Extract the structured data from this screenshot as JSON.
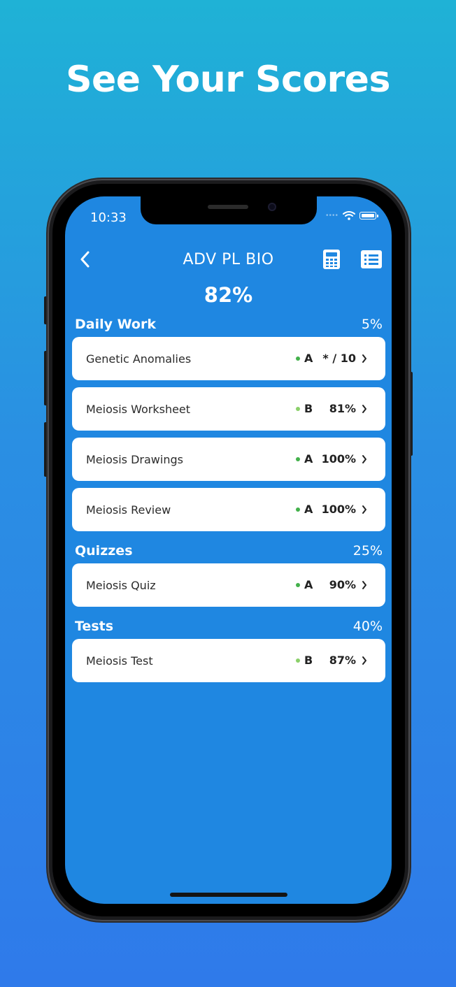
{
  "headline": "See Your Scores",
  "status_bar": {
    "time": "10:33"
  },
  "nav": {
    "title": "ADV PL BIO"
  },
  "overall_grade": "82%",
  "sections": [
    {
      "name": "Daily Work",
      "weight": "5%",
      "items": [
        {
          "name": "Genetic Anomalies",
          "letter": "A",
          "score": "* / 10",
          "dot_color": "#43b14b"
        },
        {
          "name": "Meiosis Worksheet",
          "letter": "B",
          "score": "81%",
          "dot_color": "#8bd06a"
        },
        {
          "name": "Meiosis Drawings",
          "letter": "A",
          "score": "100%",
          "dot_color": "#43b14b"
        },
        {
          "name": "Meiosis Review",
          "letter": "A",
          "score": "100%",
          "dot_color": "#43b14b"
        }
      ]
    },
    {
      "name": "Quizzes",
      "weight": "25%",
      "items": [
        {
          "name": "Meiosis Quiz",
          "letter": "A",
          "score": "90%",
          "dot_color": "#43b14b"
        }
      ]
    },
    {
      "name": "Tests",
      "weight": "40%",
      "items": [
        {
          "name": "Meiosis Test",
          "letter": "B",
          "score": "87%",
          "dot_color": "#8bd06a"
        }
      ]
    }
  ],
  "icons": {
    "back": "chevron-left-icon",
    "calculator": "calculator-icon",
    "list": "list-icon",
    "row_chevron": "chevron-right-icon"
  }
}
